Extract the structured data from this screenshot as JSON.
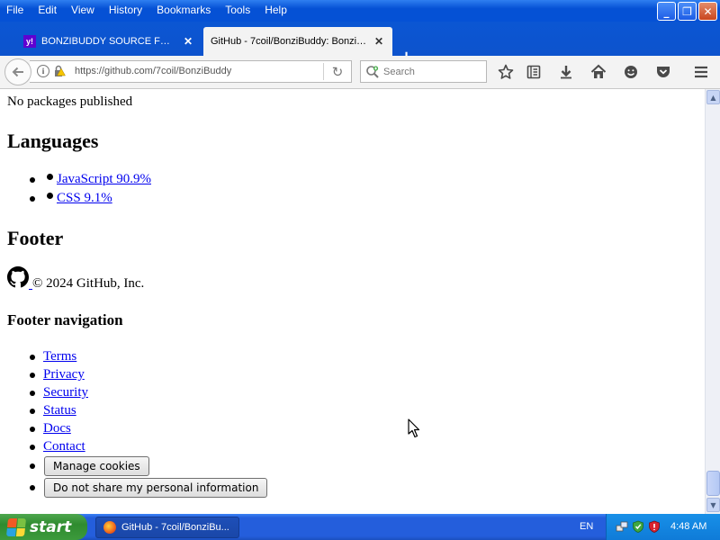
{
  "menu": {
    "items": [
      "File",
      "Edit",
      "View",
      "History",
      "Bookmarks",
      "Tools",
      "Help"
    ]
  },
  "window_controls": {
    "minimize": "_",
    "maximize": "❐",
    "close": "✕"
  },
  "tabs": [
    {
      "title": "BONZIBUDDY SOURCE FORG...",
      "close": "✕",
      "favicon": "yahoo-icon"
    },
    {
      "title": "GitHub - 7coil/BonziBuddy: BonziB...",
      "close": "✕",
      "favicon": "github-icon"
    }
  ],
  "new_tab": "+",
  "navbar": {
    "url": "https://github.com/7coil/BonziBuddy",
    "search_placeholder": "Search"
  },
  "page": {
    "packages_text": "No packages published",
    "languages_heading": "Languages",
    "languages": [
      {
        "label": " JavaScript 90.9%"
      },
      {
        "label": " CSS 9.1%"
      }
    ],
    "footer_heading": "Footer",
    "copyright": "© 2024 GitHub, Inc.",
    "footer_nav_heading": "Footer navigation",
    "footer_links": [
      "Terms",
      "Privacy",
      "Security",
      "Status",
      "Docs",
      "Contact"
    ],
    "manage_cookies": "Manage cookies",
    "do_not_share": "Do not share my personal information"
  },
  "taskbar": {
    "start_label": "start",
    "task_title": "GitHub - 7coil/BonziBu...",
    "language": "EN",
    "clock": "4:48 AM"
  },
  "colors": {
    "link": "#0000ee",
    "titlebar": "#0551d5",
    "taskbar": "#245edc",
    "start": "#2f8b2f"
  }
}
